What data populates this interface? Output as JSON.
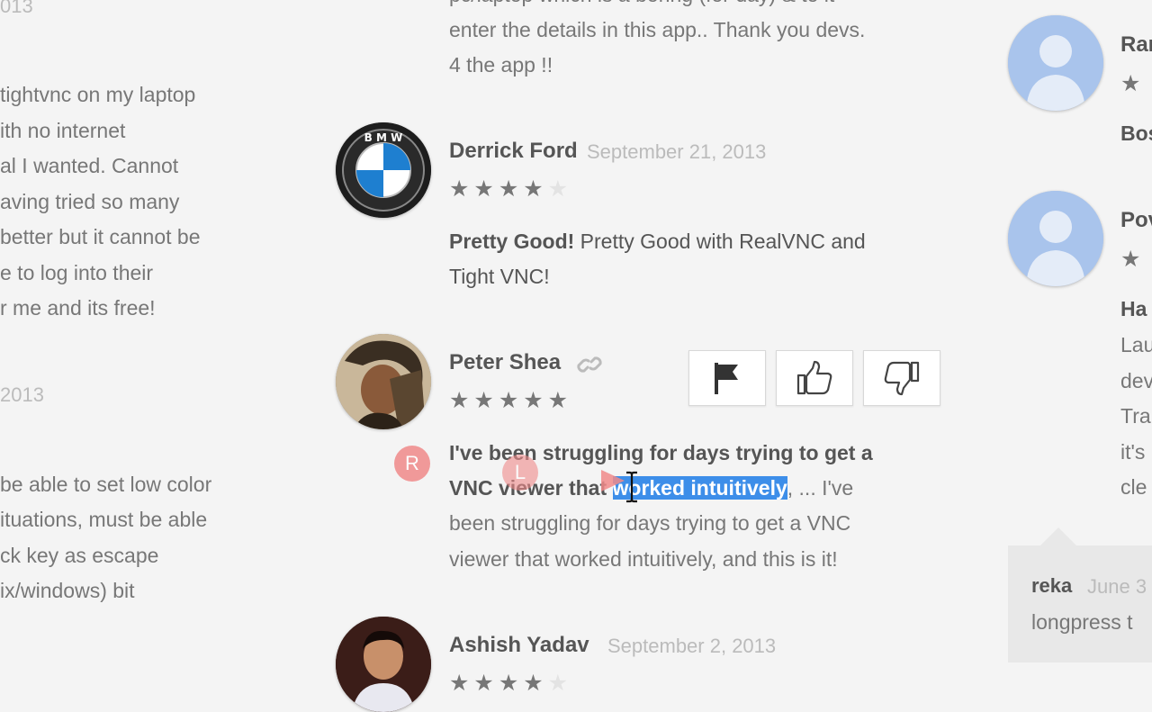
{
  "left_column": {
    "top_date": "013",
    "review1_lines": [
      "tightvnc on my laptop",
      "ith no internet",
      "al I wanted. Cannot",
      "aving tried so many",
      "better but it cannot be",
      "e to log into their",
      "r me and its free!"
    ],
    "review2_date": "2013",
    "review2_lines": [
      "be able to set low color",
      "ituations, must be able",
      "ck key as escape",
      "ix/windows) bit"
    ]
  },
  "center_column": {
    "top_review_lines": [
      "pc/laptop which is a boring (for day) & to it",
      "enter the details in this app.. Thank you devs.",
      "4 the app !!"
    ],
    "reviews": [
      {
        "author": "Derrick Ford",
        "date": "September 21, 2013",
        "rating": 4,
        "title": "Pretty Good!",
        "body_line1": " Pretty Good with RealVNC and",
        "body_line2": "Tight VNC!"
      },
      {
        "author": "Peter Shea",
        "rating": 5,
        "title_line1": "I've been struggling for days trying to get a",
        "title_line2_pre": "VNC viewer that ",
        "title_line2_selected": "worked intuitively",
        "title_line2_post": ", ... I've",
        "body_line1": "been struggling for days trying to get a VNC",
        "body_line2": "viewer that worked intuitively, and this is it!"
      },
      {
        "author": "Ashish Yadav",
        "date": "September 2, 2013",
        "rating": 4
      }
    ],
    "stars_full": "★★★★★",
    "stars_four_on": "★★★★",
    "stars_four_off": "★",
    "actions": {
      "flag_icon": "flag-icon",
      "thumbs_up_icon": "thumbs-up-icon",
      "thumbs_down_icon": "thumbs-down-icon"
    },
    "markers": {
      "right_click": "R",
      "left_click": "L"
    }
  },
  "right_column": {
    "reviewer1_name": "Ran",
    "reviewer1_stars": "★",
    "reviewer1_text": "Bos",
    "reviewer2_name": "Pov",
    "reviewer2_stars": "★",
    "reviewer2_title": "Ha",
    "reviewer2_lines": [
      "Lau",
      "dev",
      "Tra",
      "it's",
      "cle"
    ],
    "reply_author": "reka",
    "reply_date": "June 3",
    "reply_text": "longpress t"
  },
  "colors": {
    "selection": "#3d8ee9",
    "marker": "#f08a8a",
    "background": "#f4f4f4"
  }
}
